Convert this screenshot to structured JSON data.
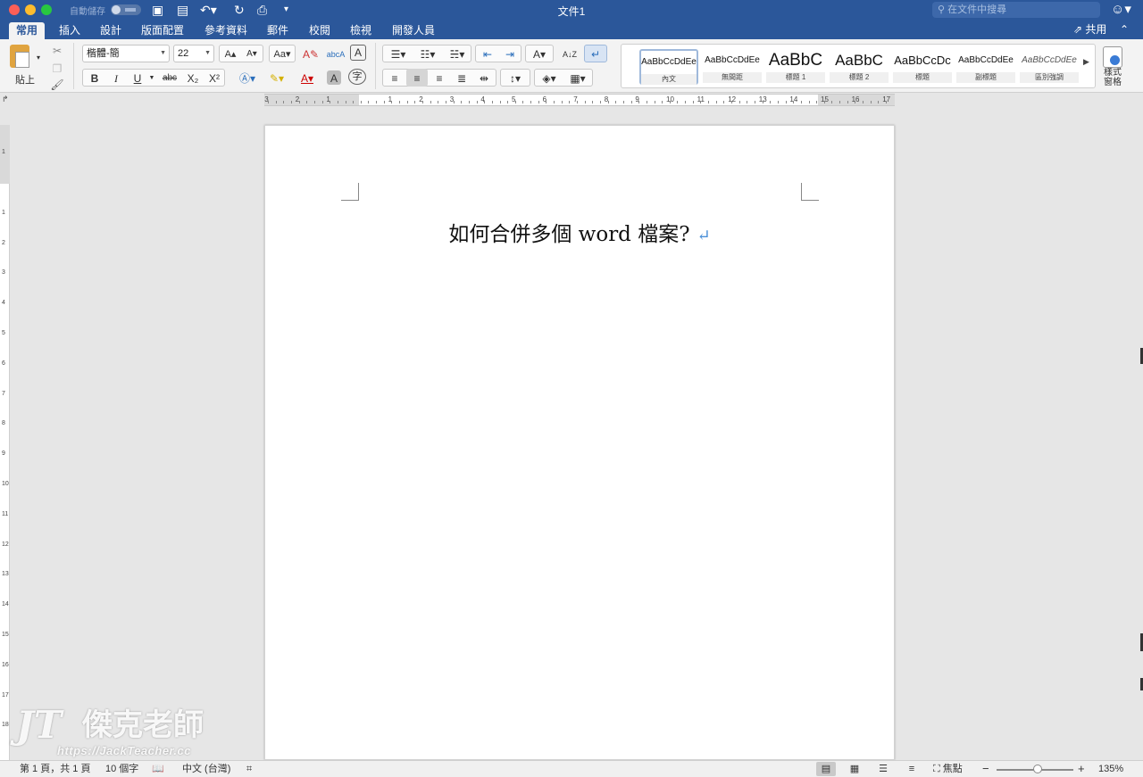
{
  "titlebar": {
    "autosave_label": "自動儲存",
    "title": "文件1",
    "search_placeholder": "在文件中搜尋"
  },
  "tabs": [
    {
      "label": "常用"
    },
    {
      "label": "插入"
    },
    {
      "label": "設計"
    },
    {
      "label": "版面配置"
    },
    {
      "label": "參考資料"
    },
    {
      "label": "郵件"
    },
    {
      "label": "校閱"
    },
    {
      "label": "檢視"
    },
    {
      "label": "開發人員"
    }
  ],
  "share_label": "共用",
  "ribbon": {
    "paste_label": "貼上",
    "font_name": "楷體-簡",
    "font_size": "22",
    "bold": "B",
    "italic": "I",
    "underline": "U",
    "strikethrough": "abc",
    "subscript": "X₂",
    "superscript": "X²",
    "font_color": "A",
    "char_shading": "A",
    "phonetic": "字"
  },
  "styles": [
    {
      "sample": "AaBbCcDdEe",
      "name": "內文"
    },
    {
      "sample": "AaBbCcDdEe",
      "name": "無間距"
    },
    {
      "sample": "AaBbC",
      "name": "標題 1"
    },
    {
      "sample": "AaBbC",
      "name": "標題 2"
    },
    {
      "sample": "AaBbCcDc",
      "name": "標題"
    },
    {
      "sample": "AaBbCcDdEe",
      "name": "副標題"
    },
    {
      "sample": "AaBbCcDdEe",
      "name": "區別強調"
    }
  ],
  "styles_pane_label": "樣式\n窗格",
  "ruler": {
    "numbers": [
      "3",
      "2",
      "1",
      "1",
      "2",
      "3",
      "4",
      "5",
      "6",
      "7",
      "8",
      "9",
      "10",
      "11",
      "12",
      "13",
      "14",
      "15",
      "16",
      "17"
    ]
  },
  "vruler": {
    "numbers": [
      "2",
      "1",
      "1",
      "2",
      "3",
      "4",
      "5",
      "6",
      "7",
      "8",
      "9",
      "10",
      "11",
      "12",
      "13",
      "14",
      "15",
      "16",
      "17",
      "18"
    ]
  },
  "document": {
    "heading": "如何合併多個 word 檔案?",
    "paragraph_mark": "↵"
  },
  "watermark": {
    "logo": "JT",
    "name": "傑克老師",
    "url": "https://JackTeacher.cc"
  },
  "statusbar": {
    "page": "第 1 頁，共 1 頁",
    "words": "10 個字",
    "language": "中文 (台灣)",
    "focus": "焦點",
    "zoom": "135%",
    "zoom_level": 0.53
  },
  "colors": {
    "accent": "#2b579a",
    "paragraph_mark": "#4a8fd8"
  }
}
